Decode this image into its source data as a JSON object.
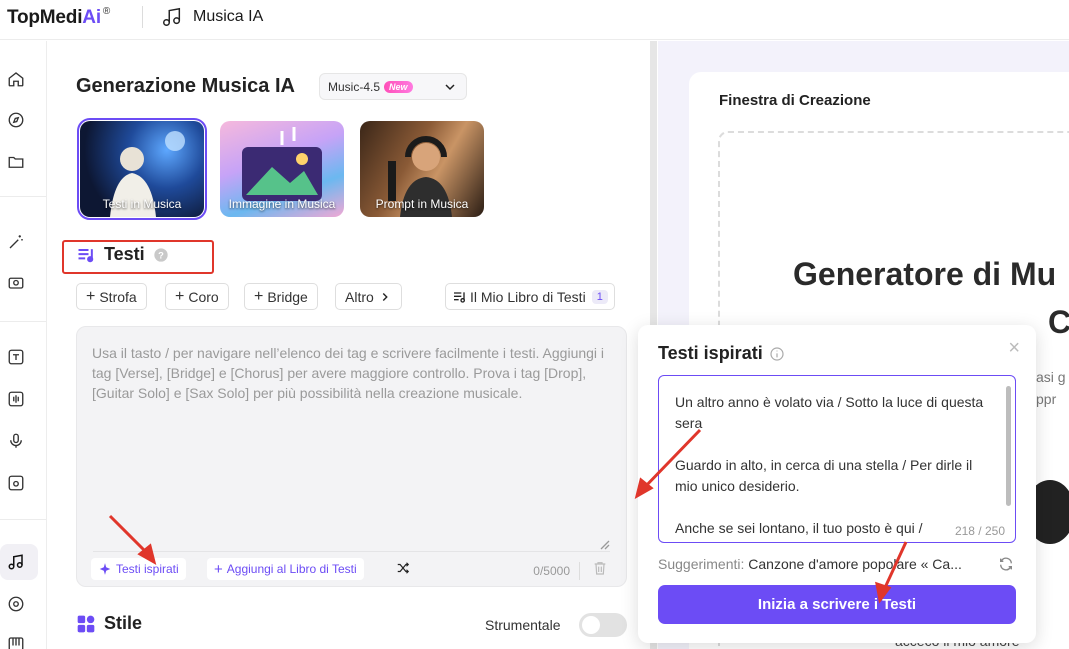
{
  "header": {
    "brand_prefix": "TopMedi",
    "brand_ai": "Ai",
    "brand_reg": "®",
    "app_title": "Musica IA"
  },
  "main": {
    "title": "Generazione Musica IA",
    "model": {
      "name": "Music-4.5",
      "badge": "New"
    },
    "modes": [
      {
        "label": "Testi in Musica",
        "selected": true
      },
      {
        "label": "Immagine in Musica",
        "selected": false
      },
      {
        "label": "Prompt in Musica",
        "selected": false
      }
    ],
    "lyrics": {
      "heading": "Testi",
      "chips": [
        "Strofa",
        "Coro",
        "Bridge"
      ],
      "more": "Altro",
      "book": "Il Mio Libro di Testi",
      "book_count": "1",
      "placeholder": "Usa il tasto / per navigare nell’elenco dei tag e scrivere facilmente i testi. Aggiungi i tag [Verse], [Bridge] e [Chorus] per avere maggiore controllo. Prova i tag [Drop], [Guitar Solo] e [Sax Solo] per più possibilità nella creazione musicale.",
      "inspired_btn": "Testi ispirati",
      "add_book_btn": "Aggiungi al Libro di Testi",
      "counter": "0/5000"
    },
    "style": {
      "heading": "Stile",
      "instrumental_label": "Strumentale",
      "instrumental_on": false
    }
  },
  "creation": {
    "title": "Finestra di Creazione",
    "big_title_line1": "Generatore di Mu",
    "big_title_line2": "C",
    "desc_frag_1": "asi g",
    "desc_frag_2": "ppr",
    "footer_frag": "accecò il mio amore"
  },
  "popup": {
    "title": "Testi ispirati",
    "lyrics_text": "Un altro anno è volato via / Sotto la luce di questa sera\n\nGuardo in alto, in cerca di una stella / Per dirle il mio unico desiderio.\n\nAnche se sei lontano, il tuo posto è qui /",
    "counter": "218 / 250",
    "suggestions_label": "Suggerimenti:",
    "suggestions_value": "Canzone d'amore popolare « Ca...",
    "cta": "Inizia a scrivere i Testi"
  },
  "colors": {
    "accent": "#6c4cf5",
    "highlight": "#e0362b"
  }
}
